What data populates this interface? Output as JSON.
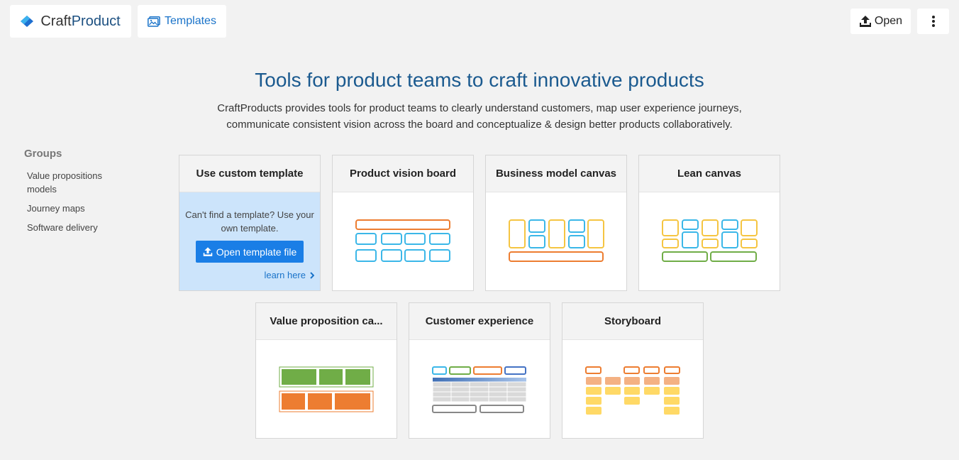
{
  "topbar": {
    "brand_prefix": "Craft",
    "brand_suffix": "Product",
    "templates_label": "Templates",
    "open_label": "Open"
  },
  "hero": {
    "title": "Tools for product teams to craft innovative products",
    "subtitle": "CraftProducts provides tools for product teams to clearly understand customers, map user experience journeys, communicate consistent vision across the board and conceptualize & design better products collaboratively."
  },
  "groups": {
    "title": "Groups",
    "items": [
      "Value propositions models",
      "Journey maps",
      "Software delivery"
    ]
  },
  "custom_template": {
    "title": "Use custom template",
    "message": "Can't find a template? Use your own template.",
    "button_label": "Open template file",
    "learn_label": "learn here"
  },
  "templates": [
    {
      "title": "Product vision board"
    },
    {
      "title": "Business model canvas"
    },
    {
      "title": "Lean canvas"
    },
    {
      "title": "Value proposition ca..."
    },
    {
      "title": "Customer experience"
    },
    {
      "title": "Storyboard"
    }
  ],
  "colors": {
    "accent": "#1a7ee6",
    "heading": "#1b5a8f",
    "orange": "#ed7d31",
    "blue": "#3bb7e8",
    "yellow": "#f5c542",
    "green": "#70ad47",
    "peach": "#f4b183",
    "gold": "#ffd966"
  }
}
